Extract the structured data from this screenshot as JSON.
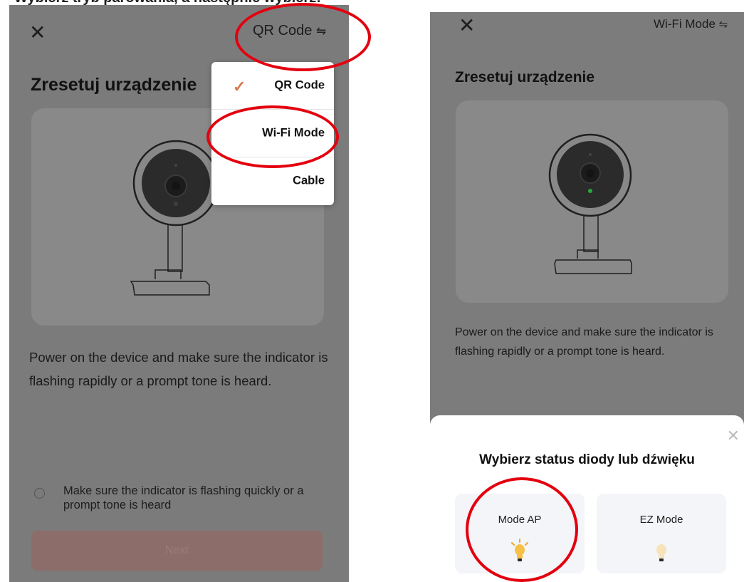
{
  "header_cut_text": "Wybierz tryb parowania, a następnie wybierz:",
  "left_screen": {
    "mode_switch_label": "QR Code",
    "mode_switch_icon": "swap-arrows-icon",
    "title": "Zresetuj urządzenie",
    "description": "Power on the device and make sure the indicator is flashing rapidly or a prompt tone is heard.",
    "confirm_checkbox_label": "Make sure the indicator is flashing quickly or a prompt tone is heard",
    "confirm_checked": false,
    "next_button_label": "Next",
    "mode_menu": {
      "items": [
        {
          "label": "QR Code",
          "selected": true
        },
        {
          "label": "Wi-Fi Mode",
          "selected": false
        },
        {
          "label": "Cable",
          "selected": false
        }
      ]
    }
  },
  "right_screen": {
    "mode_switch_label": "Wi-Fi Mode",
    "mode_switch_icon": "swap-arrows-icon",
    "title": "Zresetuj urządzenie",
    "description": "Power on the device and make sure the indicator is flashing rapidly or a prompt tone is heard.",
    "sheet": {
      "title": "Wybierz status diody lub dźwięku",
      "options": [
        {
          "label": "Mode AP",
          "icon": "bulb-on-icon"
        },
        {
          "label": "EZ Mode",
          "icon": "bulb-off-icon"
        }
      ]
    }
  },
  "colors": {
    "annotation": "#e3000f",
    "accent_check": "#d9794f",
    "overlay_gray": "#7b7b7b"
  }
}
